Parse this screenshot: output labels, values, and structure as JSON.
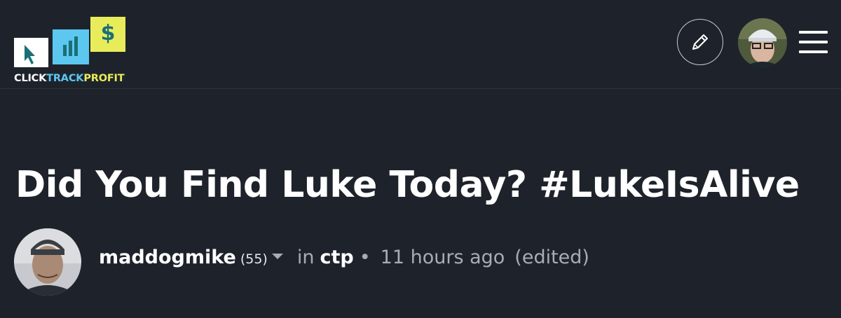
{
  "header": {
    "logo": {
      "text_part1": "CLICK",
      "text_part2": "TRACK",
      "text_part3": "PROFIT",
      "icon_name": "clicktrackprofit-logo",
      "colors": {
        "white": "#ffffff",
        "blue": "#5cc8f0",
        "yellow": "#e9ec5a",
        "teal": "#1a6f76"
      }
    },
    "edit_icon": "pencil-icon",
    "menu_icon": "hamburger-icon"
  },
  "post": {
    "title": "Did You Find Luke Today? #LukeIsAlive",
    "author": "maddogmike",
    "reputation": "(55)",
    "in_label": "in",
    "community": "ctp",
    "separator": "•",
    "time": "11 hours ago",
    "edited": "(edited)"
  },
  "colors": {
    "background": "#1e232b",
    "title": "#ffffff",
    "meta_text": "#a7adb6"
  }
}
